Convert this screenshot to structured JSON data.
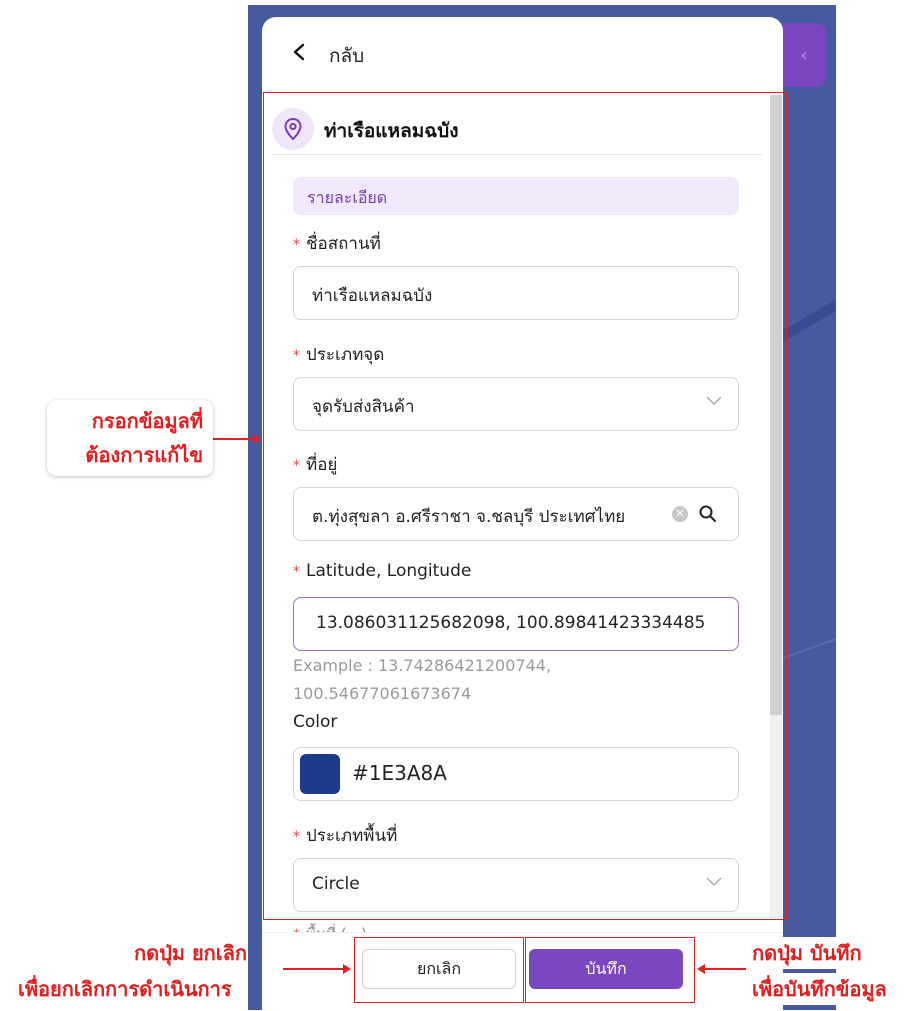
{
  "header": {
    "back_label": "กลับ"
  },
  "place": {
    "name": "ท่าเรือแหลมฉบัง"
  },
  "section": {
    "title": "รายละเอียด"
  },
  "form": {
    "name_label": "ชื่อสถานที่",
    "name_value": "ท่าเรือแหลมฉบัง",
    "type_label": "ประเภทจุด",
    "type_value": "จุดรับส่งสินค้า",
    "address_label": "ที่อยู่",
    "address_value": "ต.ทุ่งสุขลา อ.ศรีราชา จ.ชลบุรี ประเทศไทย",
    "latlng_label": "Latitude, Longitude",
    "latlng_value": "13.086031125682098, 100.89841423334485",
    "latlng_example_line1": "Example : 13.74286421200744,",
    "latlng_example_line2": "100.54677061673674",
    "color_label": "Color",
    "color_value": "#1E3A8A",
    "area_type_label": "ประเภทพื้นที่",
    "area_type_value": "Circle",
    "cutoff_label": "พื้นที่ (...)"
  },
  "footer": {
    "cancel_label": "ยกเลิก",
    "save_label": "บันทึก"
  },
  "annotations": {
    "fill_line1": "กรอกข้อมูลที่",
    "fill_line2": "ต้องการแก้ไข",
    "cancel_line1": "กดปุ่ม ยกเลิก",
    "cancel_line2": "เพื่อยกเลิกการดำเนินการ",
    "save_line1": "กดปุ่ม บันทึก",
    "save_line2": "เพื่อบันทึกข้อมูล"
  },
  "colors": {
    "accent": "#7A47C0",
    "swatch": "#1E3A8A",
    "annotation": "#E02020"
  },
  "icons": {
    "back": "chevron-left-icon",
    "pin": "map-pin-icon",
    "dropdown": "chevron-down-icon",
    "clear": "clear-icon",
    "search": "search-icon"
  }
}
